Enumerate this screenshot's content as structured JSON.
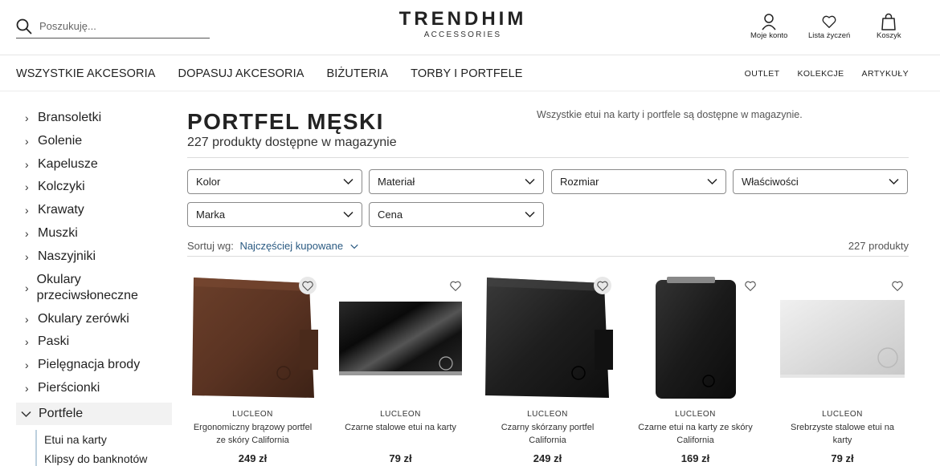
{
  "header": {
    "search_placeholder": "Poszukuję...",
    "brand": "TRENDHIM",
    "brand_sub": "ACCESSORIES",
    "account_label": "Moje konto",
    "wishlist_label": "Lista życzeń",
    "cart_label": "Koszyk"
  },
  "nav": {
    "main": [
      "WSZYSTKIE AKCESORIA",
      "DOPASUJ AKCESORIA",
      "BIŻUTERIA",
      "TORBY I PORTFELE"
    ],
    "right": [
      "OUTLET",
      "KOLEKCJE",
      "ARTYKUŁY"
    ]
  },
  "sidebar": {
    "items": [
      "Bransoletki",
      "Golenie",
      "Kapelusze",
      "Kolczyki",
      "Krawaty",
      "Muszki",
      "Naszyjniki",
      "Okulary przeciwsłoneczne",
      "Okulary zerówki",
      "Paski",
      "Pielęgnacja brody",
      "Pierścionki"
    ],
    "active": "Portfele",
    "sub_items": [
      "Etui na karty",
      "Klipsy do banknotów"
    ]
  },
  "main": {
    "title": "PORTFEL MĘSKI",
    "count": "227 produkty dostępne w magazynie",
    "notice": "Wszystkie etui na karty i portfele są dostępne w magazynie.",
    "filters": [
      "Kolor",
      "Materiał",
      "Rozmiar",
      "Właściwości",
      "Marka",
      "Cena"
    ],
    "sort_label": "Sortuj wg:",
    "sort_value": "Najczęściej kupowane",
    "total": "227 produkty"
  },
  "products": [
    {
      "brand": "LUCLEON",
      "name": "Ergonomiczny brązowy portfel ze skóry California",
      "price": "249 zł",
      "image": "brown-leather-wallet"
    },
    {
      "brand": "LUCLEON",
      "name": "Czarne stalowe etui na karty",
      "price": "79 zł",
      "image": "black-steel-card-holder"
    },
    {
      "brand": "LUCLEON",
      "name": "Czarny skórzany portfel California",
      "price": "249 zł",
      "image": "black-leather-wallet"
    },
    {
      "brand": "LUCLEON",
      "name": "Czarne etui na karty ze skóry California",
      "price": "169 zł",
      "image": "black-zip-card-wallet"
    },
    {
      "brand": "LUCLEON",
      "name": "Srebrzyste stalowe etui na karty",
      "price": "79 zł",
      "image": "silver-steel-card-holder"
    }
  ]
}
